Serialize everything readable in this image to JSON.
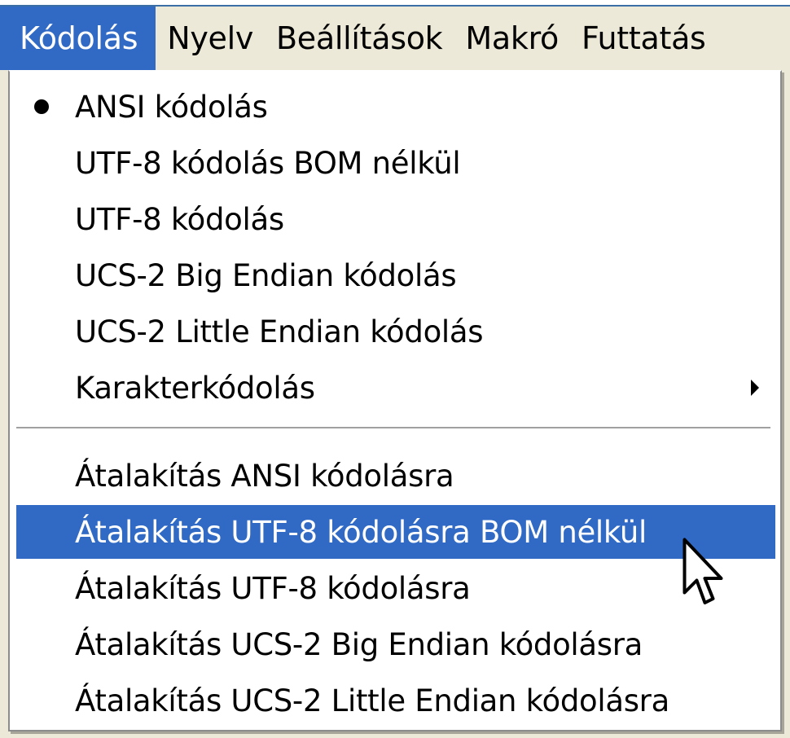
{
  "menubar": {
    "items": [
      {
        "label": "Kódolás",
        "active": true
      },
      {
        "label": "Nyelv"
      },
      {
        "label": "Beállítások"
      },
      {
        "label": "Makró"
      },
      {
        "label": "Futtatás"
      }
    ]
  },
  "encoding_menu": {
    "items": [
      {
        "label": "ANSI kódolás",
        "checked": true
      },
      {
        "label": "UTF-8 kódolás BOM nélkül"
      },
      {
        "label": "UTF-8 kódolás"
      },
      {
        "label": "UCS-2 Big Endian kódolás"
      },
      {
        "label": "UCS-2 Little Endian kódolás"
      },
      {
        "label": "Karakterkódolás",
        "has_submenu": true
      }
    ],
    "convert_items": [
      {
        "label": "Átalakítás ANSI kódolásra"
      },
      {
        "label": "Átalakítás UTF-8 kódolásra BOM nélkül",
        "highlighted": true
      },
      {
        "label": "Átalakítás UTF-8 kódolásra"
      },
      {
        "label": "Átalakítás UCS-2 Big Endian kódolásra"
      },
      {
        "label": "Átalakítás UCS-2 Little Endian kódolásra"
      }
    ]
  },
  "icons": {
    "checked_indicator": "radio-dot-icon",
    "submenu_indicator": "submenu-arrow-icon",
    "pointer": "mouse-pointer-icon"
  },
  "colors": {
    "highlight": "#316ac5",
    "highlight_text": "#ffffff",
    "menu_background": "#ffffff",
    "menubar_background": "#ece9d8"
  }
}
